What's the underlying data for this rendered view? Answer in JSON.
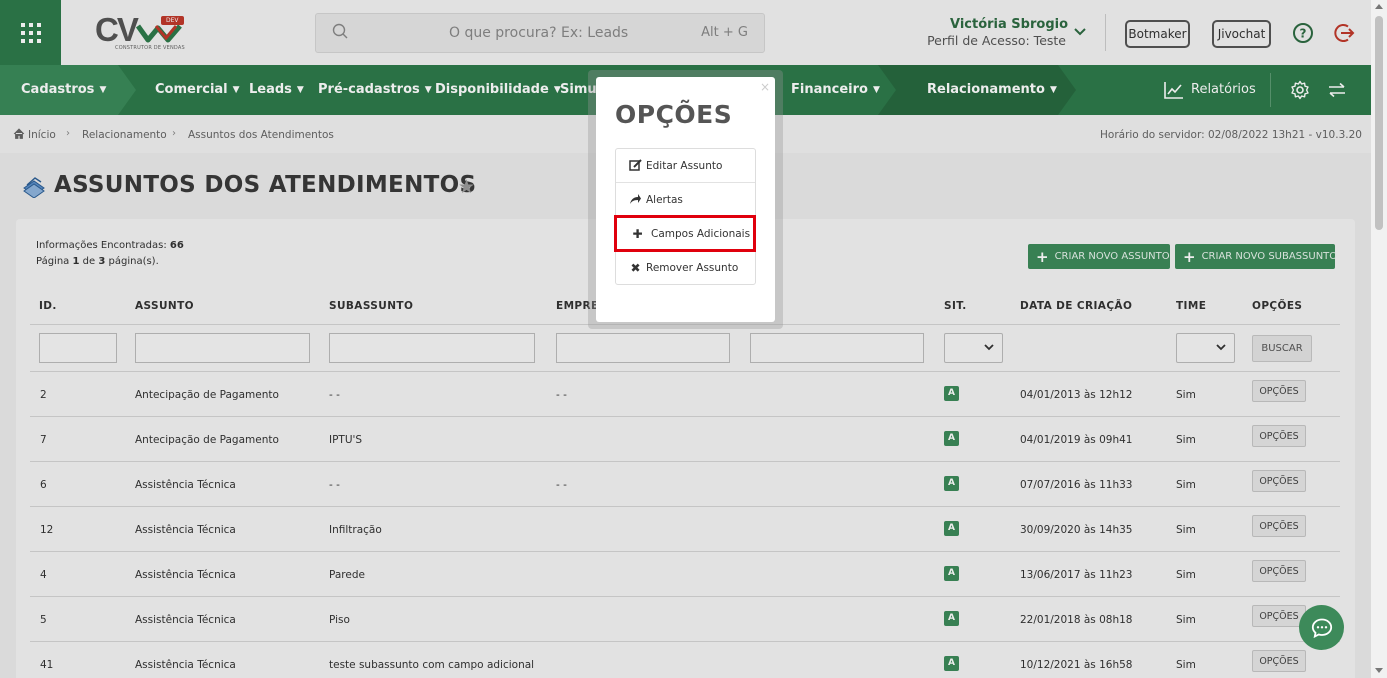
{
  "header": {
    "logo_text": "CV",
    "logo_badge": "DEV",
    "logo_subtitle": "CONSTRUTOR DE VENDAS",
    "search_placeholder": "O que procura? Ex: Leads",
    "search_shortcut": "Alt + G",
    "user_name": "Victória Sbrogio",
    "user_profile": "Perfil de Acesso: Teste",
    "botmaker_label": "Botmaker",
    "jivochat_label": "Jivochat"
  },
  "nav": {
    "items": [
      "Cadastros",
      "Comercial",
      "Leads",
      "Pré-cadastros",
      "Disponibilidade",
      "Simul",
      "Financeiro",
      "Relacionamento"
    ],
    "reports_label": "Relatórios"
  },
  "breadcrumb": {
    "home": "Início",
    "level1": "Relacionamento",
    "level2": "Assuntos dos Atendimentos",
    "server_time": "Horário do servidor: 02/08/2022 13h21 - v10.3.20"
  },
  "page": {
    "title": "ASSUNTOS DOS ATENDIMENTOS",
    "info_found_label": "Informações Encontradas:",
    "info_found_count": "66",
    "page_word": "Página",
    "page_current": "1",
    "page_of": "de",
    "page_total": "3",
    "page_suffix": "página(s).",
    "btn_new_subject": "CRIAR NOVO ASSUNTO",
    "btn_new_subsubject": "CRIAR NOVO SUBASSUNTO",
    "search_button": "BUSCAR"
  },
  "table": {
    "headers": [
      "ID.",
      "ASSUNTO",
      "SUBASSUNTO",
      "EMPRE",
      "SIT.",
      "DATA DE CRIAÇÃO",
      "TIME",
      "OPÇÕES"
    ],
    "rows": [
      {
        "id": "2",
        "assunto": "Antecipação de Pagamento",
        "subassunto": "- -",
        "empresa": "- -",
        "sit": "A",
        "data": "04/01/2013 às 12h12",
        "time": "Sim",
        "opcoes": "OPÇÕES"
      },
      {
        "id": "7",
        "assunto": "Antecipação de Pagamento",
        "subassunto": "IPTU'S",
        "empresa": "",
        "sit": "A",
        "data": "04/01/2019 às 09h41",
        "time": "Sim",
        "opcoes": "OPÇÕES"
      },
      {
        "id": "6",
        "assunto": "Assistência Técnica",
        "subassunto": "- -",
        "empresa": "- -",
        "sit": "A",
        "data": "07/07/2016 às 11h33",
        "time": "Sim",
        "opcoes": "OPÇÕES"
      },
      {
        "id": "12",
        "assunto": "Assistência Técnica",
        "subassunto": "Infiltração",
        "empresa": "",
        "sit": "A",
        "data": "30/09/2020 às 14h35",
        "time": "Sim",
        "opcoes": "OPÇÕES"
      },
      {
        "id": "4",
        "assunto": "Assistência Técnica",
        "subassunto": "Parede",
        "empresa": "",
        "sit": "A",
        "data": "13/06/2017 às 11h23",
        "time": "Sim",
        "opcoes": "OPÇÕES"
      },
      {
        "id": "5",
        "assunto": "Assistência Técnica",
        "subassunto": "Piso",
        "empresa": "",
        "sit": "A",
        "data": "22/01/2018 às 08h18",
        "time": "Sim",
        "opcoes": "OPÇÕES"
      },
      {
        "id": "41",
        "assunto": "Assistência Técnica",
        "subassunto": "teste subassunto com campo adicional",
        "empresa": "",
        "sit": "A",
        "data": "10/12/2021 às 16h58",
        "time": "Sim",
        "opcoes": "OPÇÕES"
      }
    ]
  },
  "modal": {
    "close": "×",
    "title": "OPÇÕES",
    "items": [
      "Editar Assunto",
      "Alertas",
      "Campos Adicionais",
      "Remover Assunto"
    ]
  },
  "colors": {
    "brand_green": "#2e7a4b",
    "highlight_red": "#e0000d"
  }
}
